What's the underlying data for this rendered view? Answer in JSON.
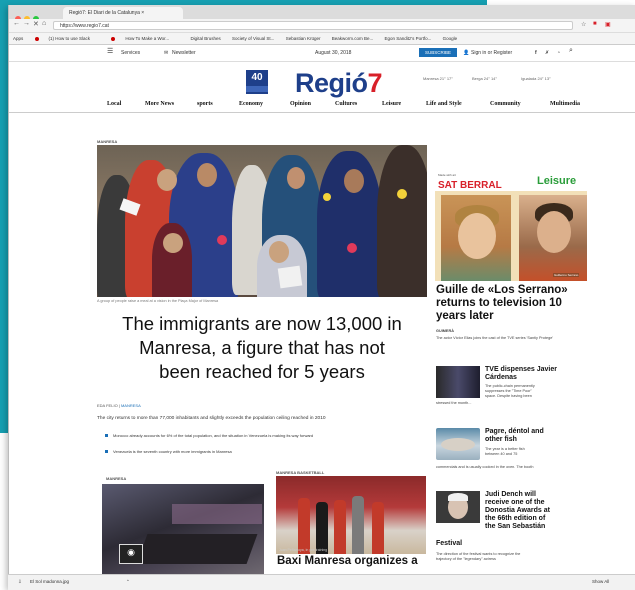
{
  "browser": {
    "tab_title": "Regió7: El Diari de la Catalunya ×",
    "tab_close": "×",
    "url": "https://www.regio7.cat",
    "bookmarks": [
      "Apps",
      "(1) How to use Slack",
      "How To Make a Wor...",
      "Digital Brushes",
      "Society of Visual St...",
      "Sebastian Krüger",
      "Beakworm.com Be...",
      "Egon Sanditz's Portfo...",
      "Google"
    ]
  },
  "site": {
    "topbar": {
      "services": "Services",
      "newsletter": "Newsletter",
      "date": "August 30, 2018",
      "subscribe": "SUBSCRIBE",
      "signin": "Sign in or Register"
    },
    "logo_main": "Regió",
    "logo_seven": "7",
    "anniversary_number": "40",
    "weather": [
      "Manresa 21° 17°",
      "Berga 24° 14°",
      "Igualada 24° 13°"
    ],
    "nav": [
      "Local",
      "More News",
      "sports",
      "Economy",
      "Opinion",
      "Cultures",
      "Leisure",
      "Life and Style",
      "Community",
      "Multimedia"
    ]
  },
  "main": {
    "kicker": "MANRESA",
    "caption": "A group of people raise a meal at a vision in the Plaça Major of Manresa",
    "headline_l1": "The immigrants are now 13,000 in",
    "headline_l2": "Manresa, a figure that has not",
    "headline_l3": "been reached for 5 years",
    "meta_author": "EDA FELIO",
    "meta_section": "MANRESA",
    "lead": "The city returns to more than 77,000 inhabitants and slightly exceeds the population ceiling reached in 2010",
    "bullets": [
      "Morocco already accounts for 6% of the total population, and the situation in Venezuela is making its way forward",
      "Venezuela is the seventh country with more immigrants in Manresa"
    ]
  },
  "bottom": {
    "left_kicker": "MANRESA",
    "right_kicker": "MANRESA BASKETBALL",
    "credit": "Joan Peñarroya, in pre-training",
    "headline": "Baxi Manresa organizes a"
  },
  "sidebar": {
    "ad_made_by": "Made with art",
    "ad_brand": "SAT BERRAL",
    "ad_section": "Leisure",
    "ad_label": "Guillermo Serrano",
    "main_title_l1": "Guille de «Los Serrano»",
    "main_title_l2": "returns to television 10",
    "main_title_l3": "years later",
    "main_kicker": "GUIMERÀ",
    "main_desc": "The actor Víctor Elias joins the cast of the TVE series 'Santiy Protege'",
    "items": [
      {
        "title_l1": "TVE dispenses Javier",
        "title_l2": "Cárdenas",
        "desc_l1": "The public-chain permanently",
        "desc_l2": "suppresses the \"Time Poor\"",
        "desc_l3": "space. Despite having been",
        "desc_l4": "stressed the month..."
      },
      {
        "title_l1": "Pagre, déntol and",
        "title_l2": "other fish",
        "desc_l1": "The year is a better fish",
        "desc_l2": "between 40 and 75",
        "desc_l3": "commercials and is usually cooked in the oven. The booth",
        "desc_l4": ""
      },
      {
        "title_l1": "Judi Dench will",
        "title_l2": "receive one of the",
        "title_l3": "Donostia Awards at",
        "title_l4": "the 66th edition of",
        "title_l5": "the San Sebastián",
        "title_l6": "Festival",
        "desc_l1": "The direction of the festival wants to recognize the",
        "desc_l2": "trajectory of the \"legendary\" actress"
      }
    ]
  },
  "status": {
    "download": "El Sol madonna.jpg",
    "show_all": "Show All"
  },
  "colors": {
    "teal": "#17a0b2",
    "brand_blue": "#1e3f8a",
    "brand_red": "#d82029",
    "leisure_green": "#2a9d3a"
  }
}
